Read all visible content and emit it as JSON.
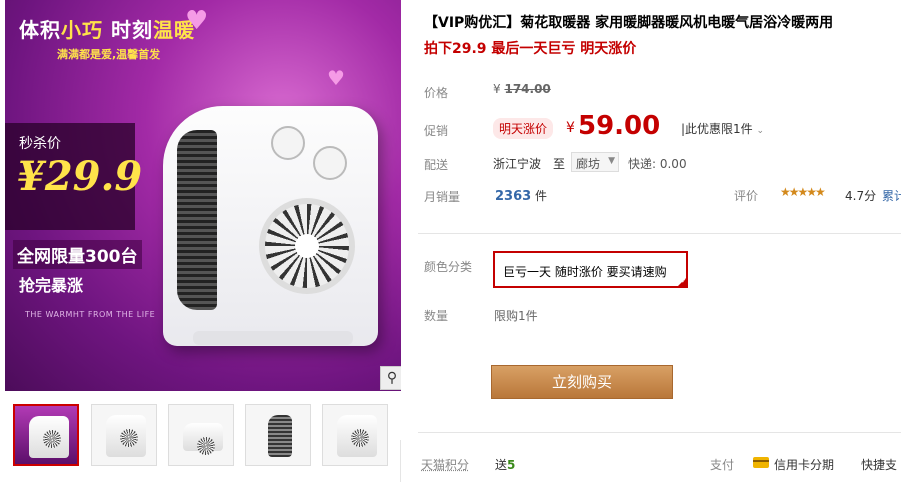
{
  "gallery": {
    "promo_title_a": "体积",
    "promo_title_b": "小巧",
    "promo_title_c": " 时刻",
    "promo_title_d": "温暖",
    "promo_sub": "满满都是爱,温馨首发",
    "flash_label": "秒杀价",
    "flash_price": "¥29.9",
    "limit_text": "全网限量300台",
    "rush_text": "抢完暴涨",
    "warm_text": "THE WARMHT FROM THE LIFE",
    "zoom_icon": "magnifier-icon",
    "thumbnails": [
      {
        "label": "thumb-1",
        "active": true
      },
      {
        "label": "thumb-2",
        "active": false
      },
      {
        "label": "thumb-3",
        "active": false
      },
      {
        "label": "thumb-4",
        "active": false
      },
      {
        "label": "thumb-5",
        "active": false
      }
    ]
  },
  "product": {
    "title": "【VIP购优汇】菊花取暖器 家用暖脚器暖风机电暖气居浴冷暖两用",
    "subtitle": "拍下29.9 最后一天巨亏 明天涨价"
  },
  "details": {
    "price_label": "价格",
    "original_currency": "¥",
    "original_price": "174.00",
    "promo_label": "促销",
    "promo_badge": "明天涨价",
    "current_currency": "¥",
    "current_price": "59.00",
    "promo_limit": "|此优惠限1件",
    "ship_label": "配送",
    "ship_from": "浙江宁波",
    "ship_to": "至",
    "destination": "廊坊",
    "express": "快递: 0.00",
    "sales_label": "月销量",
    "sales_count": "2363",
    "sales_unit": "件",
    "rating_label": "评价",
    "stars": "★★★★★",
    "rating_value": "4.7分",
    "cumulative_label": "累计"
  },
  "options": {
    "color_label": "颜色分类",
    "color_selected": "巨亏一天 随时涨价 要买请速购",
    "qty_label": "数量",
    "qty_value": "限购1件"
  },
  "actions": {
    "buy_now": "立刻购买"
  },
  "footer": {
    "points_label": "天猫积分",
    "points_prefix": "送",
    "points_value": "5",
    "pay_label": "支付",
    "card_installment": "信用卡分期",
    "quick_pay": "快捷支"
  },
  "colors": {
    "accent_red": "#c40000",
    "buy_button": "#c48544",
    "link_blue": "#3568a8"
  }
}
